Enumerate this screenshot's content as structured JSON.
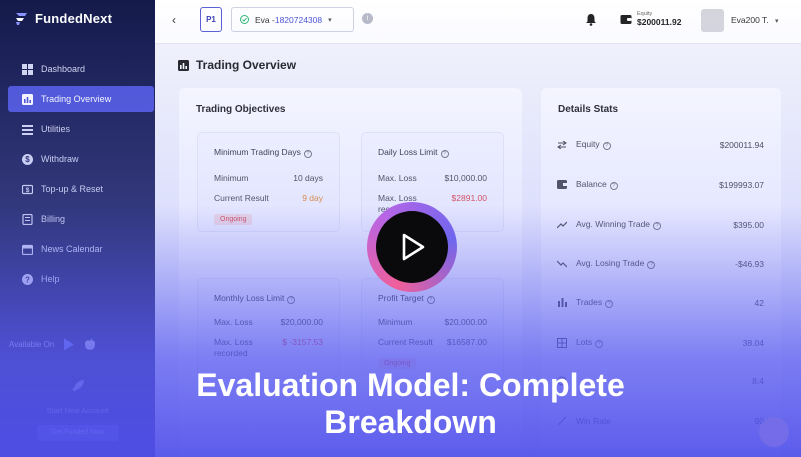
{
  "brand": {
    "name": "FundedNext"
  },
  "sidebar": {
    "items": [
      {
        "label": "Dashboard",
        "icon": "grid-icon",
        "active": false
      },
      {
        "label": "Trading Overview",
        "icon": "chart-icon",
        "active": true
      },
      {
        "label": "Utilities",
        "icon": "tools-icon",
        "active": false
      },
      {
        "label": "Withdraw",
        "icon": "dollar-icon",
        "active": false
      },
      {
        "label": "Top-up & Reset",
        "icon": "topup-icon",
        "active": false
      },
      {
        "label": "Billing",
        "icon": "billing-icon",
        "active": false
      },
      {
        "label": "News Calendar",
        "icon": "calendar-icon",
        "active": false
      },
      {
        "label": "Help",
        "icon": "help-icon",
        "active": false
      }
    ],
    "available_on": "Available On",
    "start_new_account": "Start New Account",
    "get_funded_now": "Get Funded Now"
  },
  "topbar": {
    "phase": "P1",
    "account_name": "Eva -",
    "account_number": "1820724308",
    "equity_label": "Equity",
    "equity_value": "$200011.92",
    "user_name": "Eva200 T."
  },
  "page": {
    "title": "Trading Overview"
  },
  "objectives": {
    "title": "Trading Objectives",
    "min_days": {
      "title": "Minimum Trading Days",
      "minimum_label": "Minimum",
      "minimum_value": "10 days",
      "result_label": "Current Result",
      "result_value": "9 day",
      "status": "Ongoing"
    },
    "daily_loss": {
      "title": "Daily Loss Limit",
      "max_label": "Max. Loss",
      "max_value": "$10,000.00",
      "recorded_label": "Max. Loss recorded",
      "recorded_value": "$2891.00"
    },
    "monthly_loss": {
      "title": "Monthly Loss Limit",
      "max_label": "Max. Loss",
      "max_value": "$20,000.00",
      "recorded_label": "Max. Loss recorded",
      "recorded_value": "$ -3157.53"
    },
    "profit_target": {
      "title": "Profit Target",
      "minimum_label": "Minimum",
      "minimum_value": "$20,000.00",
      "result_label": "Current Result",
      "result_value": "$16587.00",
      "status": "Ongoing"
    }
  },
  "details": {
    "title": "Details Stats",
    "rows": [
      {
        "label": "Equity",
        "value": "$200011.94",
        "icon": "swap-icon"
      },
      {
        "label": "Balance",
        "value": "$199993.07",
        "icon": "wallet-icon"
      },
      {
        "label": "Avg. Winning Trade",
        "value": "$395.00",
        "icon": "trend-up-icon"
      },
      {
        "label": "Avg. Losing Trade",
        "value": "-$46.93",
        "icon": "trend-down-icon"
      },
      {
        "label": "Trades",
        "value": "42",
        "icon": "trades-icon"
      },
      {
        "label": "Lots",
        "value": "38.04",
        "icon": "lots-icon"
      },
      {
        "label": "",
        "value": "8.4",
        "icon": "stats-icon"
      },
      {
        "label": "Win Rate",
        "value": "90",
        "icon": "winrate-icon"
      }
    ]
  },
  "overlay": {
    "headline_line1": "Evaluation Model: Complete",
    "headline_line2": "Breakdown"
  },
  "colors": {
    "sidebar_bg": "#141a4a",
    "accent": "#4b53d6",
    "danger": "#e4423b",
    "warning": "#e88a1c"
  }
}
